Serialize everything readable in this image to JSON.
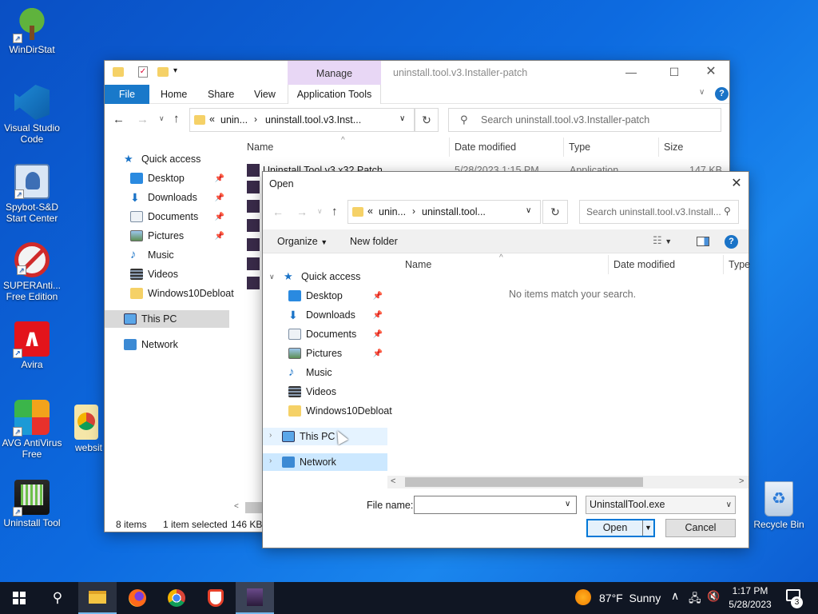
{
  "desktop": {
    "icons": [
      {
        "label": "WinDirStat"
      },
      {
        "label": "Visual Studio Code"
      },
      {
        "label": "Spybot-S&D Start Center"
      },
      {
        "label": "SUPERAnti... Free Edition"
      },
      {
        "label": "Avira"
      },
      {
        "label": "AVG AntiVirus Free"
      },
      {
        "label": "websit"
      },
      {
        "label": "Uninstall Tool"
      },
      {
        "label": "Recycle Bin"
      }
    ]
  },
  "explorer": {
    "title": "uninstall.tool.v3.Installer-patch",
    "context_tab": "Manage",
    "ribbon_tabs": [
      "File",
      "Home",
      "Share",
      "View",
      "Application Tools"
    ],
    "address": "uninstall.tool.v3.Inst...",
    "address_prefix": "unin...",
    "search_placeholder": "Search uninstall.tool.v3.Installer-patch",
    "columns": {
      "name": "Name",
      "date": "Date modified",
      "type": "Type",
      "size": "Size"
    },
    "first_file": {
      "name": "Uninstall Tool v3 x32 Patch",
      "date": "5/28/2023 1:15 PM",
      "type": "Application",
      "size": "147 KB"
    },
    "nav": {
      "quick_access": "Quick access",
      "items": [
        "Desktop",
        "Downloads",
        "Documents",
        "Pictures",
        "Music",
        "Videos",
        "Windows10Debloat"
      ],
      "this_pc": "This PC",
      "network": "Network"
    },
    "status": {
      "count": "8 items",
      "selected": "1 item selected",
      "size": "146 KB"
    }
  },
  "dialog": {
    "title": "Open",
    "address_prefix": "unin...",
    "address": "uninstall.tool...",
    "search_placeholder": "Search uninstall.tool.v3.Install...",
    "organize": "Organize",
    "new_folder": "New folder",
    "columns": {
      "name": "Name",
      "date": "Date modified",
      "type": "Type"
    },
    "empty_message": "No items match your search.",
    "nav": {
      "quick_access": "Quick access",
      "items": [
        "Desktop",
        "Downloads",
        "Documents",
        "Pictures",
        "Music",
        "Videos",
        "Windows10Debloat"
      ],
      "this_pc": "This PC",
      "network": "Network"
    },
    "file_name_label": "File name:",
    "file_name_value": "",
    "filter": "UninstallTool.exe",
    "open_button": "Open",
    "cancel_button": "Cancel"
  },
  "taskbar": {
    "weather": "87°F  Sunny",
    "time": "1:17 PM",
    "date": "5/28/2023",
    "notification_count": "3"
  },
  "colors": {
    "accent": "#0078d7",
    "manage_tab": "#e8d7f5",
    "selection": "#cce8ff",
    "taskbar": "#101623"
  }
}
